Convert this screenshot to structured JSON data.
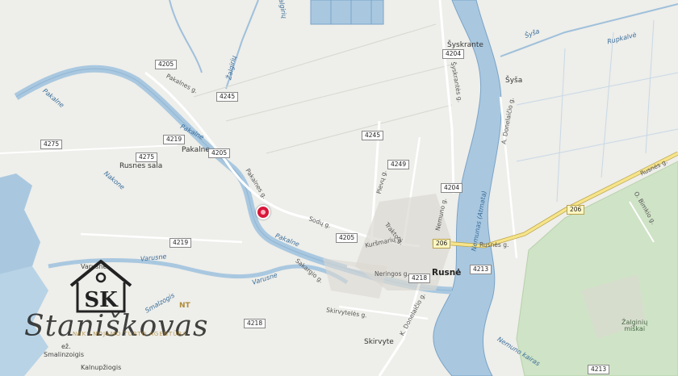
{
  "places": {
    "rusne": "Rusnė",
    "pakalne": "Pakalne",
    "rusnes_sala": "Rusnes sala",
    "syskrante": "Šyskrante",
    "sysa": "Šyša",
    "skirvyte": "Skirvyte",
    "varusne": "Varusne",
    "smalininkai": "Smalinzoigis",
    "kalnupziogis": "Kalnupžiogis",
    "ez": "ež.",
    "zalginiu_miskai": "Žalginių\nmiškai"
  },
  "waters": {
    "pakalne_river": "Pakalne",
    "pakalne_river2": "Pakalne",
    "varusne_river": "Varusne",
    "varusne_river2": "Varusne",
    "nakone": "Nakone",
    "zalgiriu": "Žalgirių",
    "rupkalve": "Rupkalvė",
    "sysa_river": "Šyša",
    "nemunas": "Nemunas (Atmata)",
    "smalzogis": "Smalzogis",
    "nemuno_kairas": "Nemuno kairas",
    "zalgiriu_upe": "Žalgirių"
  },
  "streets": {
    "pakalnes1": "Pakalnes g.",
    "pakalnes2": "Pakalnes g.",
    "sodu": "Sodų g.",
    "kursmariu": "Kuršmarių g.",
    "neringos": "Neringos g.",
    "skirvyteles": "Skirvytelės g.",
    "kdonelaicio": "K. Donelaičio g.",
    "sakargio": "Sakargio g.",
    "pievu": "Pievų g.",
    "rusnes": "Rusnės g.",
    "rusnes2": "Rusnės g.",
    "trakto": "Trakto g.",
    "nemuno": "Nemuno g.",
    "syskrantes": "Šyskrantės g.",
    "adonelaicio": "A. Donelaičio g.",
    "obimkio": "O. Bimkio g."
  },
  "shields": {
    "r4205a": "4205",
    "r4245a": "4245",
    "r4219a": "4219",
    "r4205b": "4205",
    "r4275a": "4275",
    "r4275b": "4275",
    "r4245b": "4245",
    "r4249": "4249",
    "r4204a": "4204",
    "r4204b": "4204",
    "r4219b": "4219",
    "r4205c": "4205",
    "r4218a": "4218",
    "r4218b": "4218",
    "r4213a": "4213",
    "r4213b": "4213",
    "r206a": "206",
    "r206b": "206"
  },
  "logo": {
    "monogram": "SK",
    "script": "Staniškovas",
    "nt": "NT",
    "sub": "NEKILNOJAMO TURTO AGENTŪRA"
  },
  "colors": {
    "land": "#eeeeea",
    "water": "#a9c8e0",
    "river_edge": "#7aa3c7",
    "forest": "#cfe3c6",
    "road_major": "#f6e48a",
    "marker": "#d8173a"
  }
}
